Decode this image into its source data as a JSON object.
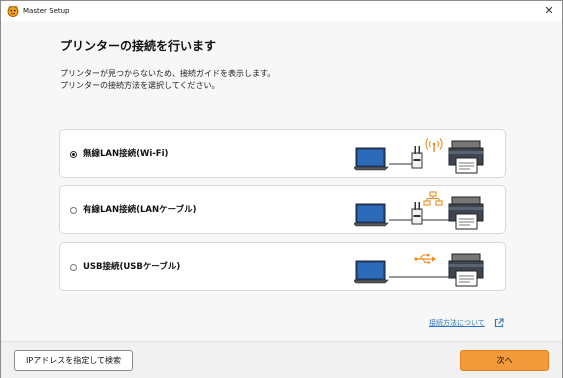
{
  "window": {
    "title": "Master Setup",
    "close_glyph": "✕"
  },
  "main": {
    "heading": "プリンターの接続を行います",
    "description_line1": "プリンターが見つからないため、接続ガイドを表示します。",
    "description_line2": "プリンターの接続方法を選択してください。"
  },
  "options": [
    {
      "label": "無線LAN接続(Wi-Fi)",
      "selected": true,
      "connection_icon": "wifi-signal-icon"
    },
    {
      "label": "有線LAN接続(LANケーブル)",
      "selected": false,
      "connection_icon": "network-icon"
    },
    {
      "label": "USB接続(USBケーブル)",
      "selected": false,
      "connection_icon": "usb-icon"
    }
  ],
  "help": {
    "link_text": "接続方法について",
    "icon": "external-link-icon"
  },
  "footer": {
    "ip_button_label": "IPアドレスを指定して検索",
    "next_button_label": "次へ"
  },
  "colors": {
    "accent_orange": "#f39a3a",
    "icon_orange": "#f08a1c",
    "link_blue": "#2a76c2",
    "laptop_blue": "#1e4f8f"
  }
}
